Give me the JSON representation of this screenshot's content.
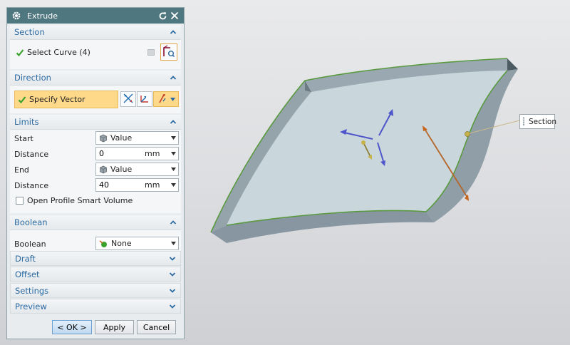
{
  "dialog": {
    "title": "Extrude",
    "section": {
      "title": "Section",
      "select_curve_label": "Select Curve (4)"
    },
    "direction": {
      "title": "Direction",
      "specify_vector_label": "Specify Vector"
    },
    "limits": {
      "title": "Limits",
      "start_label": "Start",
      "start_value": "Value",
      "start_distance_label": "Distance",
      "start_distance_value": "0",
      "start_unit": "mm",
      "end_label": "End",
      "end_value": "Value",
      "end_distance_label": "Distance",
      "end_distance_value": "40",
      "end_unit": "mm",
      "open_profile_label": "Open Profile Smart Volume"
    },
    "boolean": {
      "title": "Boolean",
      "boolean_label": "Boolean",
      "boolean_value": "None"
    },
    "draft": {
      "title": "Draft"
    },
    "offset": {
      "title": "Offset"
    },
    "settings": {
      "title": "Settings"
    },
    "preview": {
      "title": "Preview"
    },
    "buttons": {
      "ok": "< OK >",
      "apply": "Apply",
      "cancel": "Cancel"
    }
  },
  "viewport": {
    "section_callout": "Section"
  },
  "colors": {
    "titlebar": "#4f7780",
    "group_title": "#2b6aa2",
    "check_green": "#3aa12c",
    "vector_highlight": "#ffd98a",
    "sheet_top": "#c6d3d9",
    "sheet_side": "#8e9ea7",
    "edge_green": "#5a9a3f",
    "arrow_blue": "#4e55c9",
    "arrow_orange": "#c8651a"
  },
  "icons": {
    "title": "gear-icon",
    "reset": "reset-icon",
    "close": "close-icon",
    "curve_rule": "curve-rule-icon",
    "sketch_section": "sketch-section-icon",
    "reverse_direction": "reverse-direction-icon",
    "vector_constructor": "vector-constructor-icon",
    "inferred_vector": "inferred-vector-icon"
  }
}
